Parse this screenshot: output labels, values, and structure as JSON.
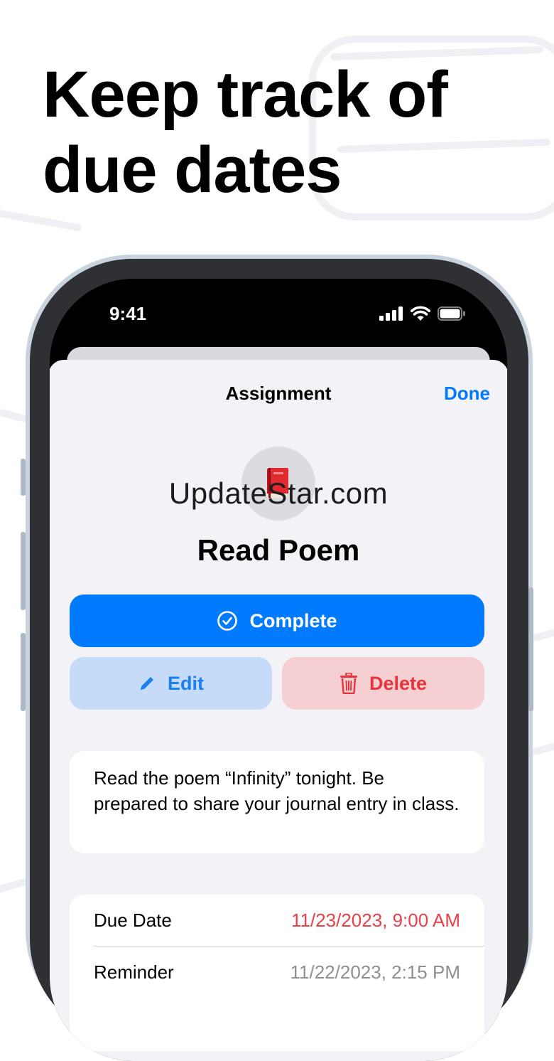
{
  "headline": {
    "line1": "Keep track of",
    "line2": "due dates"
  },
  "status_bar": {
    "time": "9:41",
    "icons": [
      "cellular-signal-icon",
      "wifi-icon",
      "battery-icon"
    ]
  },
  "sheet": {
    "title": "Assignment",
    "done_label": "Done",
    "assignment_icon": "red-book-icon",
    "watermark": "UpdateStar.com",
    "task_title": "Read Poem",
    "buttons": {
      "complete": "Complete",
      "edit": "Edit",
      "delete": "Delete"
    },
    "description": "Read the poem “Infinity” tonight. Be prepared to share your journal entry in class.",
    "details": [
      {
        "label": "Due Date",
        "value": "11/23/2023, 9:00 AM"
      },
      {
        "label": "Reminder",
        "value": "11/22/2023, 2:15 PM"
      }
    ]
  },
  "colors": {
    "accent": "#007aff",
    "danger": "#e8353d",
    "sheet_bg": "#f2f2f7"
  }
}
